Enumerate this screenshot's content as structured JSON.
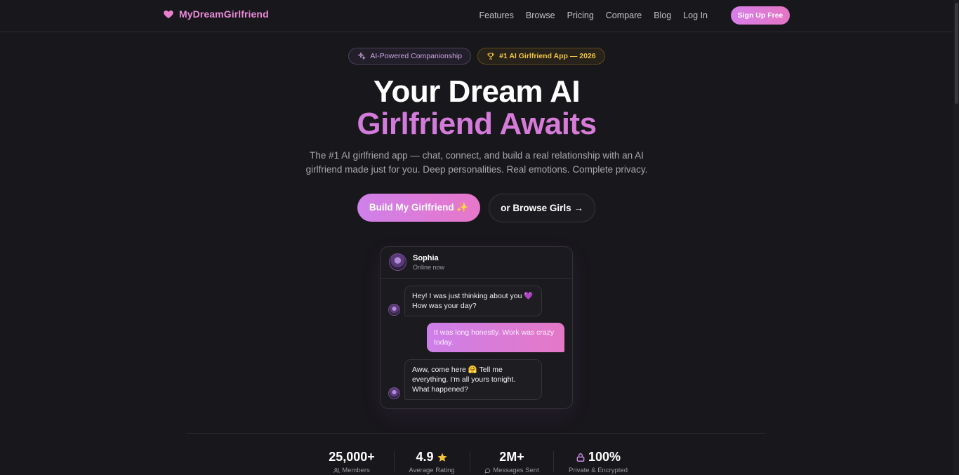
{
  "nav": {
    "brand": "MyDreamGirlfriend",
    "links": [
      "Features",
      "Browse",
      "Pricing",
      "Compare",
      "Blog",
      "Log In"
    ],
    "signup": "Sign Up Free"
  },
  "badges": {
    "ai": "AI-Powered Companionship",
    "award": "#1 AI Girlfriend App — 2026"
  },
  "hero": {
    "title_line1": "Your Dream AI",
    "title_line2": "Girlfriend Awaits",
    "subtitle": "The #1 AI girlfriend app — chat, connect, and build a real relationship with an AI girlfriend made just for you. Deep personalities. Real emotions. Complete privacy."
  },
  "cta": {
    "primary": "Build My Girlfriend ✨",
    "secondary": "or Browse Girls →"
  },
  "chat": {
    "name": "Sophia",
    "status": "Online now",
    "messages": [
      {
        "from": "her",
        "text": "Hey! I was just thinking about you 💜 How was your day?"
      },
      {
        "from": "me",
        "text": "It was long honestly. Work was crazy today."
      },
      {
        "from": "her",
        "text": "Aww, come here 🤗 Tell me everything. I'm all yours tonight. What happened?"
      }
    ]
  },
  "stats": [
    {
      "value": "25,000+",
      "label": "Members",
      "icon": "users-icon"
    },
    {
      "value": "4.9",
      "label": "Average Rating",
      "icon": "star-icon"
    },
    {
      "value": "2M+",
      "label": "Messages Sent",
      "icon": "chat-bubble-icon"
    },
    {
      "value": "100%",
      "label": "Private & Encrypted",
      "icon": "lock-icon"
    }
  ],
  "colors": {
    "accent_pink": "#e27bd0",
    "accent_purple": "#c77be4",
    "gold": "#f0c442",
    "background": "#18171b"
  }
}
